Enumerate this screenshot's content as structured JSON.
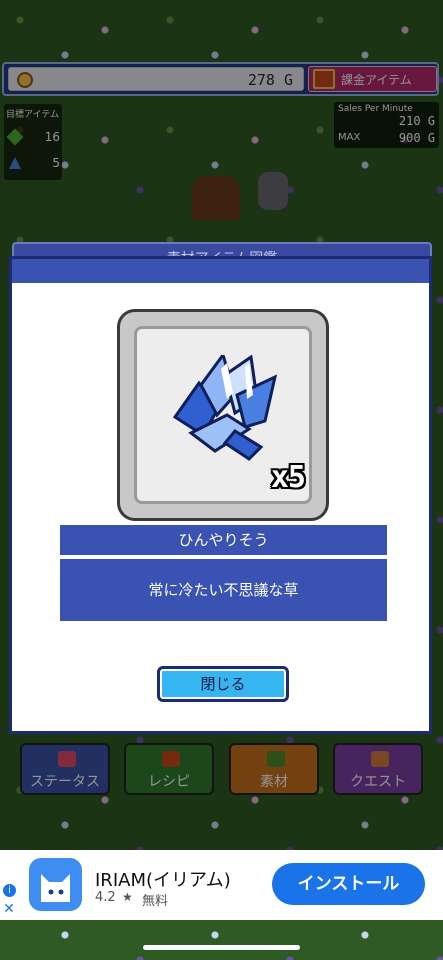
{
  "hud": {
    "gold_value": "278 G",
    "shop_label": "課金アイテム",
    "quest_title": "目標アイテム",
    "quest_rows": [
      {
        "icon": "leaf-icon",
        "value": "16"
      },
      {
        "icon": "crystal-icon",
        "value": "5"
      }
    ],
    "sales_label": "Sales Per Minute",
    "sales_value": "210 G",
    "max_label": "MAX",
    "max_value": "900 G"
  },
  "catalog": {
    "header_title": "素材アイテム図鑑"
  },
  "dialog": {
    "item_count": "x5",
    "item_name": "ひんやりそう",
    "item_description": "常に冷たい不思議な草",
    "close_label": "閉じる",
    "item_icon": "ice-grass-icon"
  },
  "bottom_menu": {
    "status": "ステータス",
    "recipe": "レシピ",
    "material": "素材",
    "quest": "クエスト"
  },
  "ad": {
    "app_name": "IRIAM(イリアム)",
    "rating": "4.2",
    "price": "無料",
    "install_label": "インストール",
    "info_glyph": "i",
    "close_glyph": "✕",
    "star_glyph": "★"
  },
  "colors": {
    "dialog_blue": "#3a52b2",
    "close_button": "#35b6f0",
    "install_button": "#1a73e8",
    "dialog_border": "#1b2b75"
  }
}
